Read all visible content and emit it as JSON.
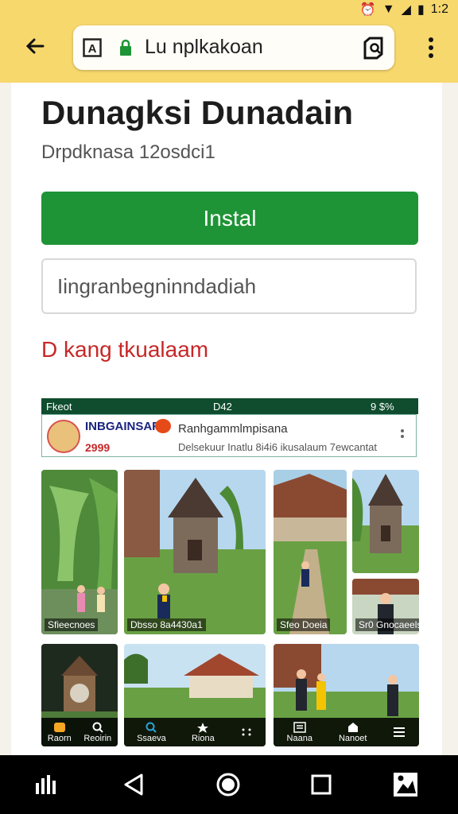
{
  "status_bar": {
    "time": "1:2"
  },
  "browser": {
    "url": "Lu nplkakoan",
    "icons": {
      "back": "back-arrow-icon",
      "reader": "reader-mode-icon",
      "lock": "lock-icon",
      "tab": "tab-switcher-icon",
      "menu": "more-vert-icon"
    }
  },
  "page": {
    "title": "Dunagksi Dunadain",
    "subtitle": "Drpdknasa 12osdci1",
    "install_label": "Instal",
    "field_value": "Iingranbegninndadiah",
    "alert": "D kang tkualaam",
    "accent": "#1e9436",
    "alert_color": "#c62828"
  },
  "preview": {
    "status_left": "Fkeot",
    "status_time": "D42",
    "status_right": "9 $%",
    "notification": {
      "brand": "INBGAINSAR",
      "price": "2999",
      "title": "Ranhgammlmpisana",
      "desc": "Delsekuur Inatlu  8i4i6 ikusalaum 7ewcantat"
    },
    "photos": [
      {
        "caption": "Sfieecnoes"
      },
      {
        "caption": "Dbsso 8a4430a1"
      },
      {
        "caption": "Sfeo Doeia"
      },
      {
        "caption": "Sr0 Gnocaeels"
      }
    ],
    "tabbar_left": [
      "Raorn",
      "Reoirin"
    ],
    "tabbar_mid": [
      "Ssaeva",
      "Riona",
      ""
    ],
    "tabbar_right": [
      "Naana",
      "Nanoet",
      ""
    ]
  },
  "nav": {
    "icons": [
      "recent-apps-icon",
      "back-icon",
      "home-icon",
      "overview-icon",
      "screenshot-icon"
    ]
  }
}
